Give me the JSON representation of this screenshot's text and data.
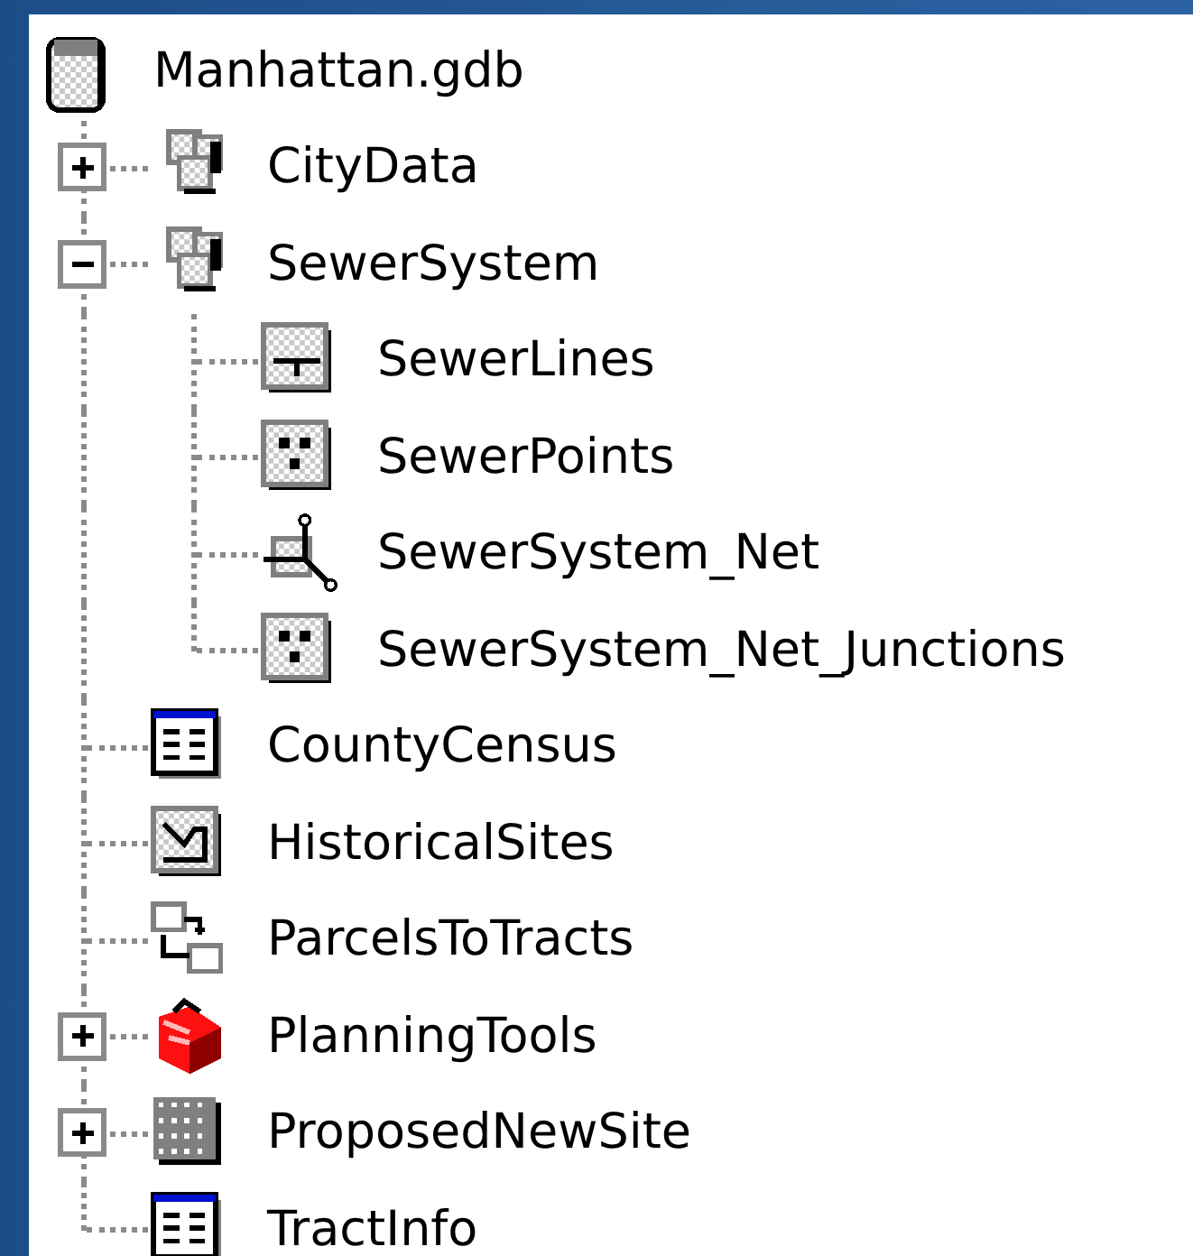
{
  "tree": {
    "label": "Manhattan.gdb",
    "kind": "database",
    "children": [
      {
        "label": "CityData",
        "kind": "dataset",
        "expanded": false
      },
      {
        "label": "SewerSystem",
        "kind": "dataset",
        "expanded": true,
        "children": [
          {
            "label": "SewerLines",
            "kind": "lines"
          },
          {
            "label": "SewerPoints",
            "kind": "points"
          },
          {
            "label": "SewerSystem_Net",
            "kind": "network"
          },
          {
            "label": "SewerSystem_Net_Junctions",
            "kind": "points"
          }
        ]
      },
      {
        "label": "CountyCensus",
        "kind": "table"
      },
      {
        "label": "HistoricalSites",
        "kind": "polyline"
      },
      {
        "label": "ParcelsToTracts",
        "kind": "relationship"
      },
      {
        "label": "PlanningTools",
        "kind": "toolbox",
        "expanded": false
      },
      {
        "label": "ProposedNewSite",
        "kind": "raster",
        "expanded": false
      },
      {
        "label": "TractInfo",
        "kind": "table"
      }
    ]
  }
}
